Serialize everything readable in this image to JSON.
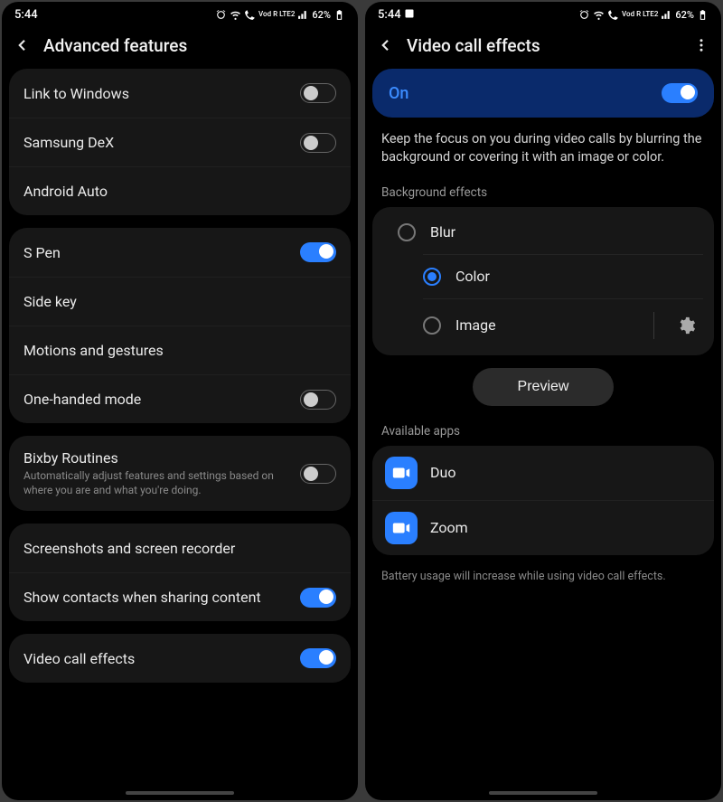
{
  "status": {
    "time": "5:44",
    "battery_text": "62%",
    "carrier_badge": "Vod R LTE2"
  },
  "left": {
    "title": "Advanced features",
    "groups": [
      {
        "items": [
          {
            "label": "Link to Windows",
            "toggle": "off"
          },
          {
            "label": "Samsung DeX",
            "toggle": "off"
          },
          {
            "label": "Android Auto"
          }
        ]
      },
      {
        "items": [
          {
            "label": "S Pen",
            "toggle": "on"
          },
          {
            "label": "Side key"
          },
          {
            "label": "Motions and gestures"
          },
          {
            "label": "One-handed mode",
            "toggle": "off"
          }
        ]
      },
      {
        "items": [
          {
            "label": "Bixby Routines",
            "sub": "Automatically adjust features and settings based on where you are and what you're doing.",
            "toggle": "off"
          }
        ]
      },
      {
        "items": [
          {
            "label": "Screenshots and screen recorder"
          },
          {
            "label": "Show contacts when sharing content",
            "toggle": "on"
          }
        ]
      },
      {
        "items": [
          {
            "label": "Video call effects",
            "toggle": "on"
          }
        ]
      }
    ]
  },
  "right": {
    "title": "Video call effects",
    "hero_label": "On",
    "description": "Keep the focus on you during video calls by blurring the background or covering it with an image or color.",
    "bg_section_label": "Background effects",
    "bg_options": [
      {
        "label": "Blur",
        "checked": false
      },
      {
        "label": "Color",
        "checked": true
      },
      {
        "label": "Image",
        "checked": false,
        "has_gear": true
      }
    ],
    "preview_label": "Preview",
    "apps_section_label": "Available apps",
    "apps": [
      {
        "label": "Duo"
      },
      {
        "label": "Zoom"
      }
    ],
    "footnote": "Battery usage will increase while using video call effects."
  }
}
